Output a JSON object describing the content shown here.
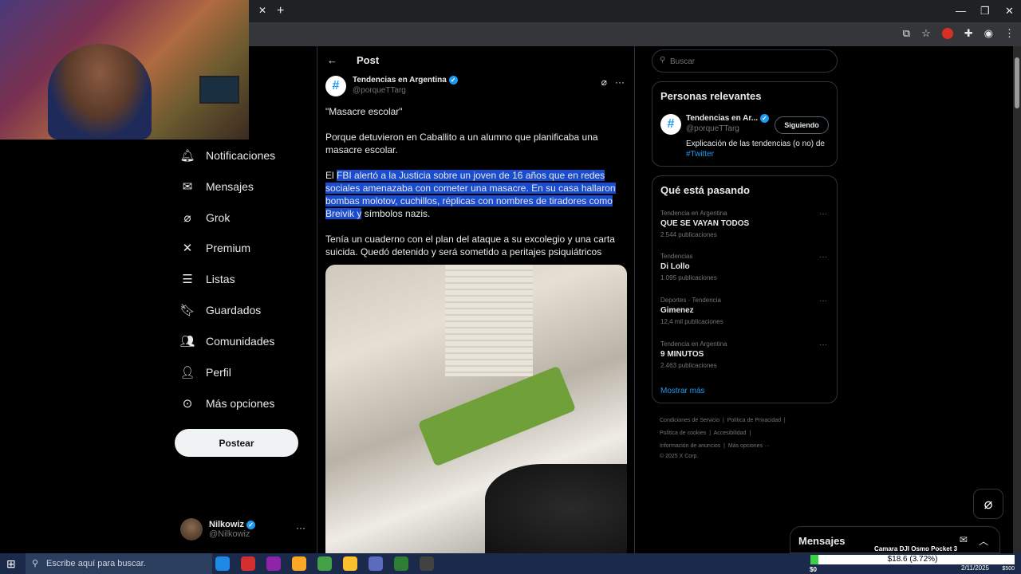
{
  "browser": {
    "tab_close": "✕",
    "tab_new": "+",
    "win_min": "—",
    "win_restore": "❐",
    "win_close": "✕"
  },
  "sidebar": {
    "items": [
      {
        "label": "Notificaciones",
        "icon": "bell-icon"
      },
      {
        "label": "Mensajes",
        "icon": "envelope-icon"
      },
      {
        "label": "Grok",
        "icon": "grok-icon"
      },
      {
        "label": "Premium",
        "icon": "x-logo-icon"
      },
      {
        "label": "Listas",
        "icon": "list-icon"
      },
      {
        "label": "Guardados",
        "icon": "bookmark-icon"
      },
      {
        "label": "Comunidades",
        "icon": "people-icon"
      },
      {
        "label": "Perfil",
        "icon": "person-icon"
      },
      {
        "label": "Más opciones",
        "icon": "more-circle-icon"
      }
    ],
    "post_button": "Postear",
    "profile": {
      "name": "Nilkowiz",
      "handle": "@Nilkowiz"
    }
  },
  "post": {
    "header": "Post",
    "author_name": "Tendencias en Argentina",
    "author_handle": "@porqueTTarg",
    "p1": "\"Masacre escolar\"",
    "p2": "Porque detuvieron en Caballito a un alumno que planificaba una masacre escolar.",
    "p3_start": "El",
    "p3_highlight": "FBI alertó a la Justicia sobre un joven de 16 años que en redes sociales amenazaba con cometer una masacre. En su casa hallaron bombas molotov, cuchillos, réplicas con nombres de tiradores como Breivik y",
    "p3_end": "símbolos nazis.",
    "p4": "Tenía un cuaderno con el plan del ataque a su excolegio y una carta suicida. Quedó detenido y será sometido a peritajes psiquiátricos"
  },
  "right": {
    "search_placeholder": "Buscar",
    "relevant_title": "Personas relevantes",
    "relevant_user": {
      "name": "Tendencias en Ar...",
      "handle": "@porqueTTarg",
      "follow": "Siguiendo",
      "desc": "Explicación de las tendencias (o no) de ",
      "desc_link": "#Twitter"
    },
    "trends_title": "Qué está pasando",
    "trends": [
      {
        "category": "Tendencia en Argentina",
        "name": "QUE SE VAYAN TODOS",
        "count": "2.544 publicaciones"
      },
      {
        "category": "Tendencias",
        "name": "Di Lollo",
        "count": "1.095 publicaciones"
      },
      {
        "category": "Deportes · Tendencia",
        "name": "Gimenez",
        "count": "12,4 mil publicaciones"
      },
      {
        "category": "Tendencia en Argentina",
        "name": "9 MINUTOS",
        "count": "2.463 publicaciones"
      }
    ],
    "show_more": "Mostrar más",
    "footer": [
      "Condiciones de Servicio",
      "Política de Privacidad",
      "Política de cookies",
      "Accesibilidad",
      "Información de anuncios",
      "Más opciones ···",
      "© 2025 X Corp."
    ]
  },
  "messages": {
    "title": "Mensajes"
  },
  "overlay": {
    "title": "Camara DJI Osmo Pocket 3",
    "amount": "$18.6 (3.72%)",
    "progress_pct": 3.72,
    "min": "$0",
    "max": "$500"
  },
  "taskbar": {
    "search_placeholder": "Escribe aquí para buscar.",
    "date": "2/11/2025"
  },
  "colors": {
    "accent": "#1d9bf0",
    "highlight": "#1a4cd0",
    "background": "#000000"
  }
}
